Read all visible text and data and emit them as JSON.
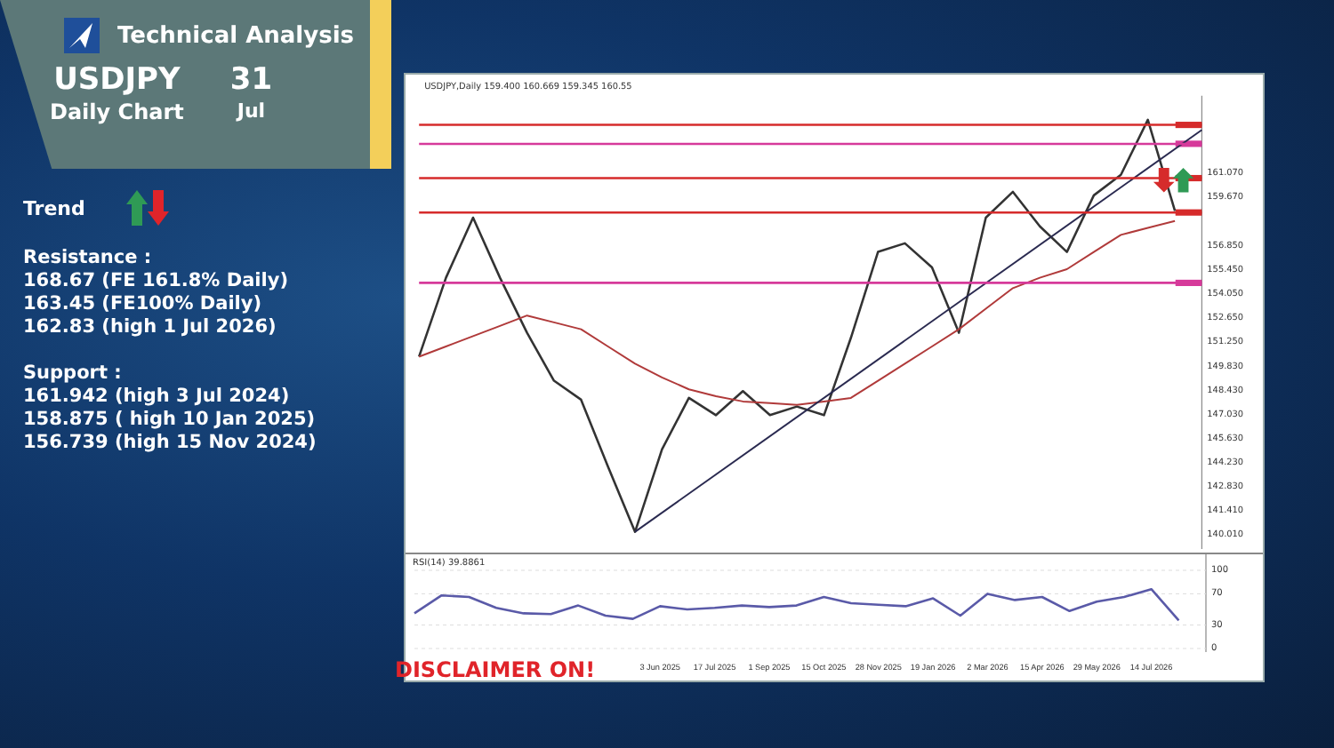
{
  "header": {
    "title": "Technical Analysis",
    "symbol": "USDJPY",
    "timeframe": "Daily Chart",
    "day": "31",
    "month": "Jul"
  },
  "trend": {
    "label": "Trend"
  },
  "resistance": {
    "heading": "Resistance :",
    "levels": [
      "168.67 (FE 161.8% Daily)",
      "163.45 (FE100% Daily)",
      "162.83 (high 1 Jul 2026)"
    ]
  },
  "support": {
    "heading": "Support :",
    "levels": [
      "161.942 (high 3 Jul 2024)",
      "158.875 ( high 10 Jan 2025)",
      "156.739 (high 15 Nov 2024)"
    ]
  },
  "chart_window": {
    "caption": "USDJPY,Daily 159.400 160.669 159.345 160.55",
    "price_chart": {
      "chart_data": {
        "type": "line",
        "categories": [
          null,
          null,
          null,
          null,
          null,
          null,
          null,
          null,
          null,
          null,
          null,
          null,
          null,
          null,
          null,
          null,
          null,
          null,
          null,
          null,
          null,
          null,
          null,
          null,
          null,
          null,
          null,
          null,
          null,
          null
        ],
        "series": [
          {
            "color": "#333333",
            "values": [
              150.4,
              155,
              158.5,
              155,
              151.8,
              149,
              147.9,
              144,
              140.2,
              145,
              148,
              147,
              148.4,
              147,
              147.5,
              147,
              151.5,
              156.5,
              157,
              155.6,
              151.8,
              158.5,
              160,
              158,
              156.5,
              159.8,
              161,
              164.2,
              158.9,
              null
            ]
          },
          {
            "color": "#b03a3a",
            "values": [
              150.4,
              151,
              151.6,
              152.2,
              152.8,
              152.4,
              152,
              151,
              150,
              149.2,
              148.5,
              148.1,
              147.8,
              147.7,
              147.6,
              147.8,
              148,
              149,
              150,
              151,
              152,
              153.2,
              154.4,
              155,
              155.5,
              156.5,
              157.5,
              157.9,
              158.3,
              null
            ]
          },
          {
            "color": "#2a2a50",
            "values": [
              null,
              null,
              null,
              null,
              null,
              null,
              null,
              null,
              140.2,
              null,
              null,
              null,
              null,
              null,
              null,
              null,
              null,
              null,
              null,
              null,
              null,
              null,
              null,
              null,
              null,
              null,
              null,
              null,
              null,
              163.6
            ]
          },
          {
            "color": "#d62b2b",
            "values": [
              163.9,
              163.9,
              163.9,
              163.9,
              163.9,
              163.9,
              163.9,
              163.9,
              163.9,
              163.9,
              163.9,
              163.9,
              163.9,
              163.9,
              163.9,
              163.9,
              163.9,
              163.9,
              163.9,
              163.9,
              163.9,
              163.9,
              163.9,
              163.9,
              163.9,
              163.9,
              163.9,
              163.9,
              163.9,
              163.9
            ]
          },
          {
            "color": "#d63a9a",
            "values": [
              162.8,
              162.8,
              162.8,
              162.8,
              162.8,
              162.8,
              162.8,
              162.8,
              162.8,
              162.8,
              162.8,
              162.8,
              162.8,
              162.8,
              162.8,
              162.8,
              162.8,
              162.8,
              162.8,
              162.8,
              162.8,
              162.8,
              162.8,
              162.8,
              162.8,
              162.8,
              162.8,
              162.8,
              162.8,
              162.8
            ]
          },
          {
            "color": "#d62b2b",
            "values": [
              160.8,
              160.8,
              160.8,
              160.8,
              160.8,
              160.8,
              160.8,
              160.8,
              160.8,
              160.8,
              160.8,
              160.8,
              160.8,
              160.8,
              160.8,
              160.8,
              160.8,
              160.8,
              160.8,
              160.8,
              160.8,
              160.8,
              160.8,
              160.8,
              160.8,
              160.8,
              160.8,
              160.8,
              160.8,
              160.8
            ]
          },
          {
            "color": "#d62b2b",
            "values": [
              158.8,
              158.8,
              158.8,
              158.8,
              158.8,
              158.8,
              158.8,
              158.8,
              158.8,
              158.8,
              158.8,
              158.8,
              158.8,
              158.8,
              158.8,
              158.8,
              158.8,
              158.8,
              158.8,
              158.8,
              158.8,
              158.8,
              158.8,
              158.8,
              158.8,
              158.8,
              158.8,
              158.8,
              158.8,
              158.8
            ]
          },
          {
            "color": "#d63a9a",
            "values": [
              154.7,
              154.7,
              154.7,
              154.7,
              154.7,
              154.7,
              154.7,
              154.7,
              154.7,
              154.7,
              154.7,
              154.7,
              154.7,
              154.7,
              154.7,
              154.7,
              154.7,
              154.7,
              154.7,
              154.7,
              154.7,
              154.7,
              154.7,
              154.7,
              154.7,
              154.7,
              154.7,
              154.7,
              154.7,
              154.7
            ]
          }
        ],
        "ylim": [
          139.2,
          165.6
        ],
        "yticks": [
          {
            "value": 161.07,
            "label": "161.070"
          },
          {
            "value": 159.67,
            "label": "159.670"
          },
          {
            "value": 156.85,
            "label": "156.850"
          },
          {
            "value": 155.45,
            "label": "155.450"
          },
          {
            "value": 154.05,
            "label": "154.050"
          },
          {
            "value": 152.65,
            "label": "152.650"
          },
          {
            "value": 151.25,
            "label": "151.250"
          },
          {
            "value": 149.83,
            "label": "149.830"
          },
          {
            "value": 148.43,
            "label": "148.430"
          },
          {
            "value": 147.03,
            "label": "147.030"
          },
          {
            "value": 145.63,
            "label": "145.630"
          },
          {
            "value": 144.23,
            "label": "144.230"
          },
          {
            "value": 142.83,
            "label": "142.830"
          },
          {
            "value": 141.41,
            "label": "141.410"
          },
          {
            "value": 140.01,
            "label": "140.010"
          }
        ]
      }
    },
    "rsi_chart": {
      "chart_data": {
        "type": "line",
        "title": "RSI(14) 39.8861",
        "categories": [
          null,
          null,
          null,
          null,
          null,
          null,
          null,
          null,
          null,
          "3 Jun 2025",
          null,
          "17 Jul 2025",
          null,
          "1 Sep 2025",
          null,
          "15 Oct 2025",
          null,
          "28 Nov 2025",
          null,
          "19 Jan 2026",
          null,
          "2 Mar 2026",
          null,
          "15 Apr 2026",
          null,
          "29 May 2026",
          null,
          "14 Jul 2026",
          null,
          null
        ],
        "series": [
          {
            "color": "#5a5aa8",
            "values": [
              45,
              68,
              66,
              52,
              45,
              44,
              55,
              42,
              38,
              54,
              50,
              52,
              55,
              53,
              55,
              66,
              58,
              56,
              54,
              64,
              42,
              70,
              62,
              66,
              48,
              60,
              66,
              76,
              36,
              null
            ]
          }
        ],
        "ylim": [
          0,
          100
        ],
        "yticks": [
          100,
          70,
          30,
          0
        ]
      }
    }
  },
  "disclaimer": "DISCLAIMER ON!"
}
